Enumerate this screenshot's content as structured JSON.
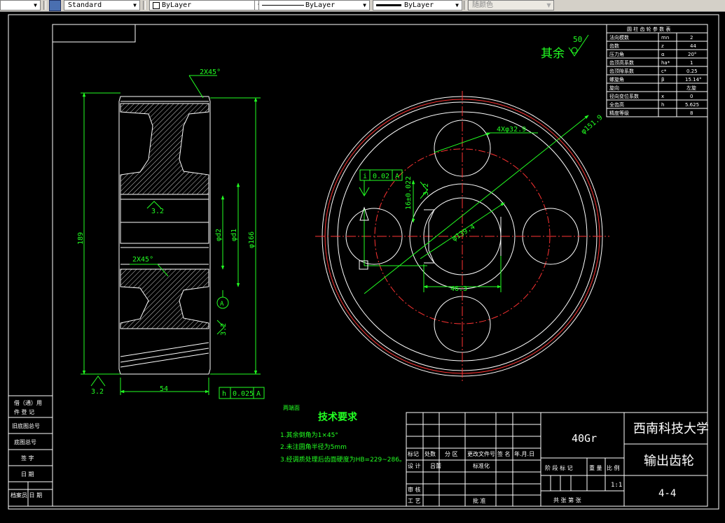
{
  "toolbar": {
    "text_style": "Standard",
    "layer": "ByLayer",
    "linetype": "ByLayer",
    "lineweight": "ByLayer",
    "color": "随颜色"
  },
  "drawing": {
    "roughness_other": "其余",
    "roughness_other_value": "50",
    "chamfer_top": "2X45°",
    "chamfer_mid": "2X45°",
    "roughness_left": "3.2",
    "roughness_bottom": "3.2",
    "roughness_right": "3.2",
    "roughness_key": "3.2",
    "dim_height": "189",
    "dim_d1": "φd1",
    "dim_d2": "φd2",
    "dim_d166": "φ166",
    "dim_width": "54",
    "datum_a": "A",
    "flatness_value": "0.025",
    "flatness_datum": "A",
    "keyway_tol_value": "0.02",
    "keyway_tol_datum": "A",
    "keyway_tol_symbol": "i",
    "dim_keyway_width": "16±0.022",
    "dim_keyslot": "46.3",
    "dim_bore": "φ139.4",
    "dim_od": "φ151.9",
    "dim_holes": "4Xφ32.9",
    "side_note": "两端面"
  },
  "params_table": {
    "title": "圆 柱 齿 轮 参 数 表",
    "rows": [
      {
        "name": "法向模数",
        "sym": "mn",
        "val": "2"
      },
      {
        "name": "齿数",
        "sym": "z",
        "val": "44"
      },
      {
        "name": "压力角",
        "sym": "α",
        "val": "20°"
      },
      {
        "name": "齿顶高系数",
        "sym": "ha*",
        "val": "1"
      },
      {
        "name": "齿顶隙系数",
        "sym": "c*",
        "val": "0.25"
      },
      {
        "name": "螺旋角",
        "sym": "β",
        "val": "15.14°"
      },
      {
        "name": "旋向",
        "sym": "",
        "val": "左旋"
      },
      {
        "name": "径向变位系数",
        "sym": "x",
        "val": "0"
      },
      {
        "name": "全齿高",
        "sym": "h",
        "val": "5.625"
      },
      {
        "name": "精度等级",
        "sym": "",
        "val": "8"
      }
    ]
  },
  "tech": {
    "title": "技术要求",
    "items": [
      "1.其余倒角为1×45°",
      "2.未注圆角半径为5mm",
      "3.经调质处理后齿面硬度为HB=229~286。"
    ]
  },
  "left_strip": {
    "rows": [
      "借（通）用",
      "件 登 记",
      "旧底图总号",
      "底图总号",
      "签  字",
      "日  期",
      "档案员  日  期"
    ]
  },
  "title_block": {
    "material": "40Gr",
    "university": "西南科技大学",
    "part_name": "输出齿轮",
    "drawing_no": "4-4",
    "scale": "1:1",
    "labels": {
      "mark": "标记",
      "count": "处数",
      "zone": "分 区",
      "change_doc": "更改文件号",
      "sign": "签 名",
      "date": "年.月.日",
      "design": "设 计",
      "standardize": "标准化",
      "stage_mark": "阶 段 标 记",
      "weight": "重 量",
      "ratio": "比 例",
      "review": "审 核",
      "process": "工 艺",
      "approve": "批 准",
      "total": "共   张   第   张",
      "signature": "吕蕾"
    }
  },
  "colors": {
    "background": "#000000",
    "line": "#ffffff",
    "dimension": "#22ff22",
    "center": "#ff3333",
    "hatch": "#d8d8d8"
  }
}
